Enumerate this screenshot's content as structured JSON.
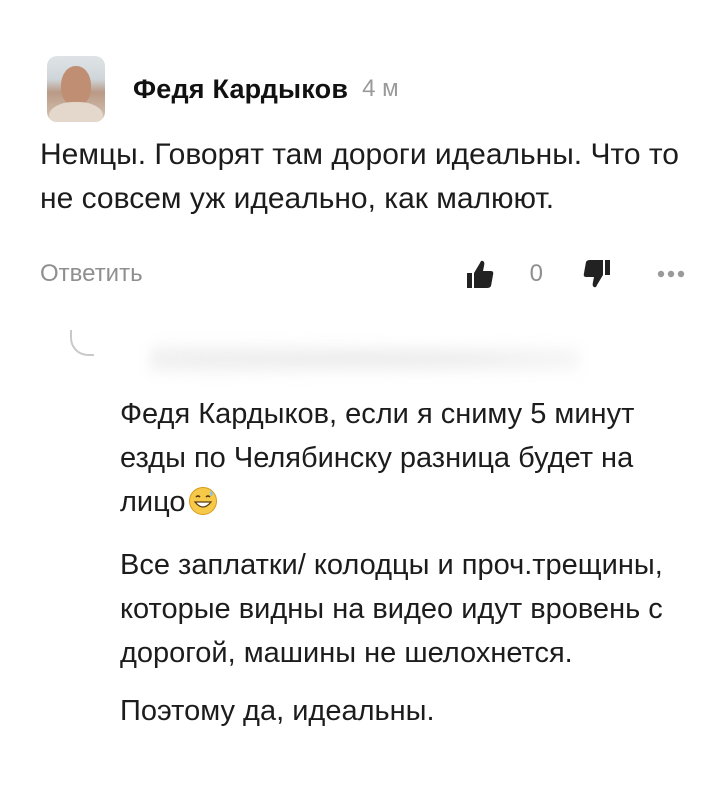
{
  "comment": {
    "author": "Федя Кардыков",
    "time": "4 м",
    "text": "Немцы. Говорят там дороги идеальны. Что то не совсем уж идеально, как малюют.",
    "actions": {
      "reply_label": "Ответить",
      "like_count": "0",
      "like_icon": "thumbs-up-icon",
      "dislike_icon": "thumbs-down-icon",
      "more_icon": "more-dots-icon"
    }
  },
  "reply": {
    "paragraphs": [
      "Федя Кардыков, если я сниму 5 минут езды по Челябинску разница будет на лицо",
      "Все заплатки/ колодцы и проч.трещины, которые видны на видео идут вровень с дорогой, машины не шелохнется.",
      "Поэтому да, идеальны."
    ],
    "emoji": "grinning-sweat-emoji"
  }
}
